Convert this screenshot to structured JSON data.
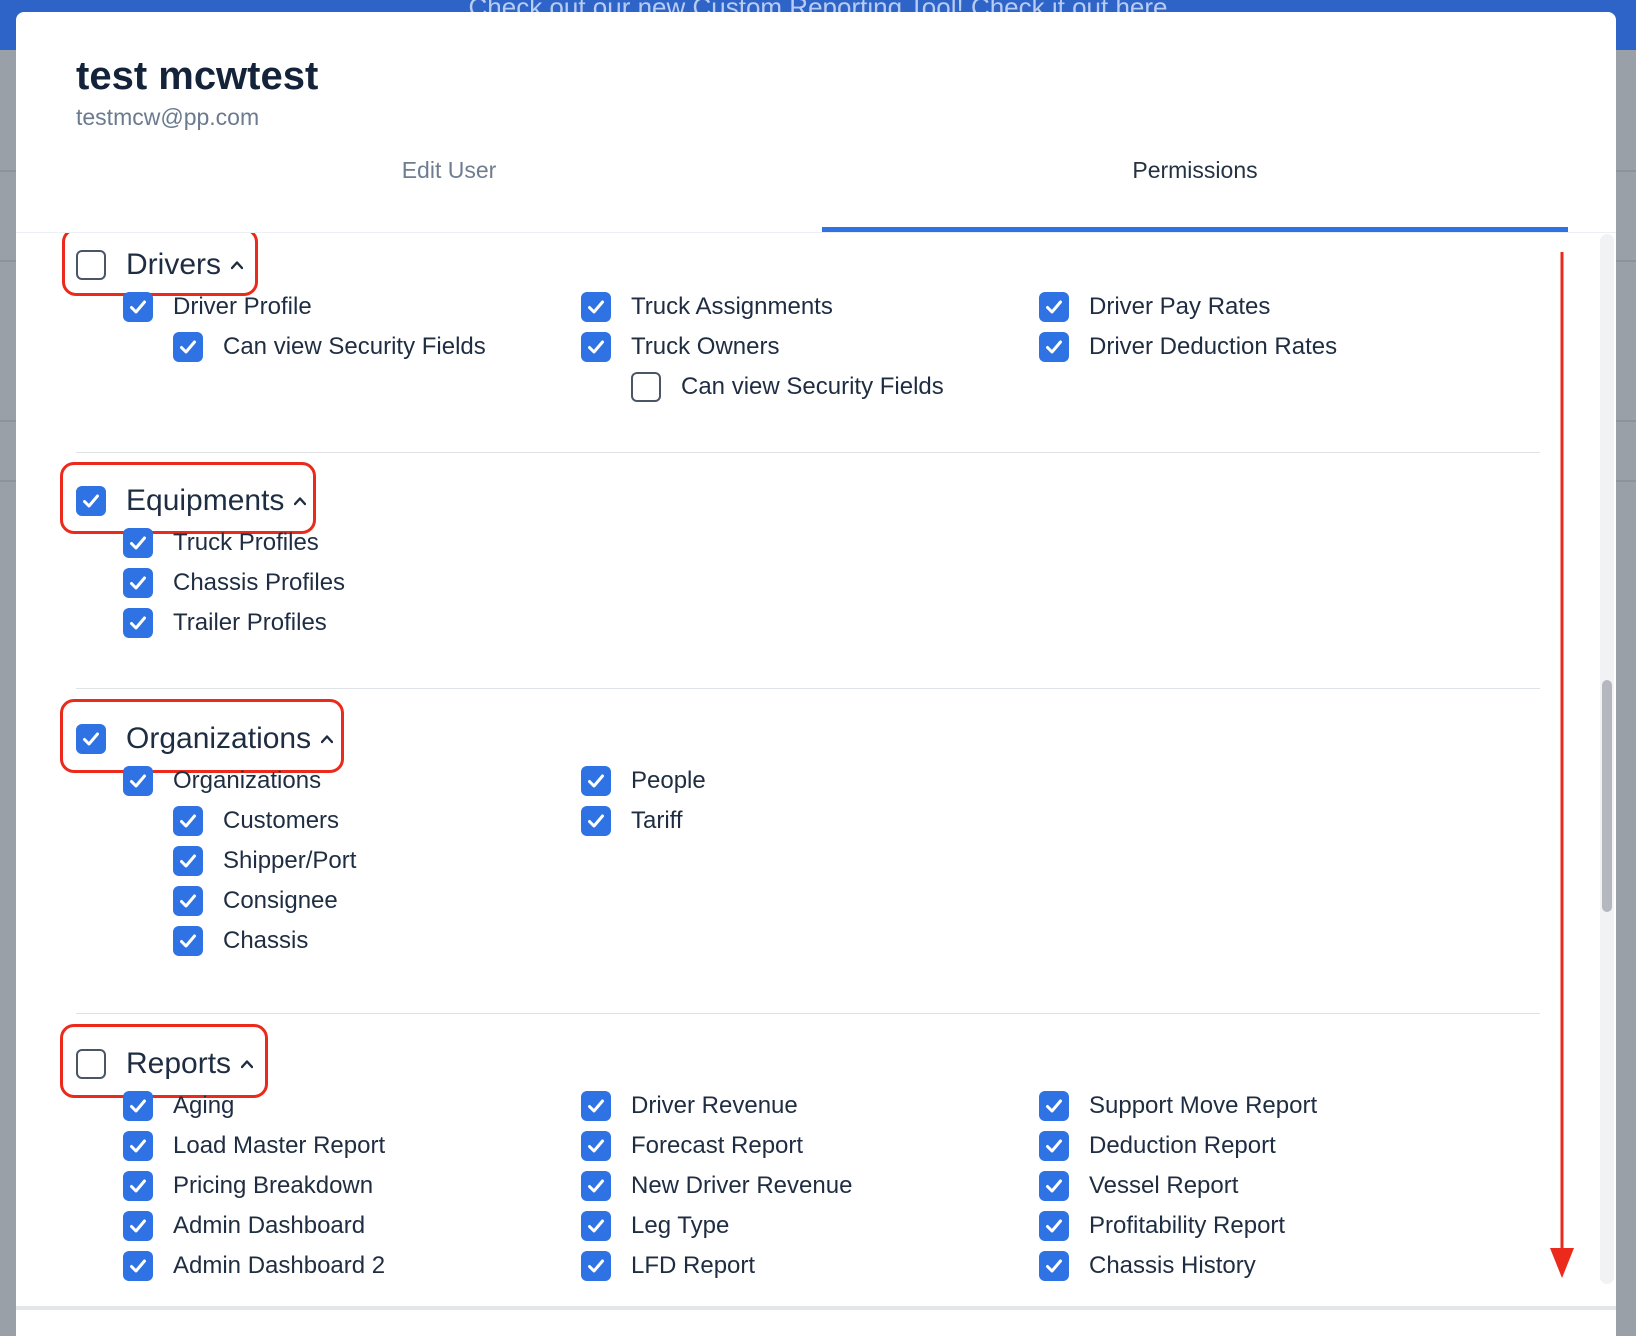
{
  "banner": {
    "text": "Check out our new Custom Reporting Tool!  Check it out here"
  },
  "user": {
    "name": "test mcwtest",
    "email": "testmcw@pp.com"
  },
  "tabs": [
    {
      "label": "Edit User",
      "active": false
    },
    {
      "label": "Permissions",
      "active": true
    }
  ],
  "sections": {
    "drivers": {
      "title": "Drivers",
      "checked": false,
      "items": [
        {
          "label": "Driver Profile",
          "checked": true
        },
        {
          "label": "Can view Security Fields",
          "checked": true
        },
        {
          "label": "Truck Assignments",
          "checked": true
        },
        {
          "label": "Truck Owners",
          "checked": true
        },
        {
          "label": "Can view Security Fields",
          "checked": false
        },
        {
          "label": "Driver Pay Rates",
          "checked": true
        },
        {
          "label": "Driver Deduction Rates",
          "checked": true
        }
      ]
    },
    "equipments": {
      "title": "Equipments",
      "checked": true,
      "items": [
        {
          "label": "Truck Profiles",
          "checked": true
        },
        {
          "label": "Chassis Profiles",
          "checked": true
        },
        {
          "label": "Trailer Profiles",
          "checked": true
        }
      ]
    },
    "organizations": {
      "title": "Organizations",
      "checked": true,
      "items": [
        {
          "label": "Organizations",
          "checked": true
        },
        {
          "label": "Customers",
          "checked": true
        },
        {
          "label": "Shipper/Port",
          "checked": true
        },
        {
          "label": "Consignee",
          "checked": true
        },
        {
          "label": "Chassis",
          "checked": true
        },
        {
          "label": "People",
          "checked": true
        },
        {
          "label": "Tariff",
          "checked": true
        }
      ]
    },
    "reports": {
      "title": "Reports",
      "checked": false,
      "items": [
        {
          "label": "Aging",
          "checked": true
        },
        {
          "label": "Load Master Report",
          "checked": true
        },
        {
          "label": "Pricing Breakdown",
          "checked": true
        },
        {
          "label": "Admin Dashboard",
          "checked": true
        },
        {
          "label": "Admin Dashboard 2",
          "checked": true
        },
        {
          "label": "Driver Revenue",
          "checked": true
        },
        {
          "label": "Forecast Report",
          "checked": true
        },
        {
          "label": "New Driver Revenue",
          "checked": true
        },
        {
          "label": "Leg Type",
          "checked": true
        },
        {
          "label": "LFD Report",
          "checked": true
        },
        {
          "label": "Support Move Report",
          "checked": true
        },
        {
          "label": "Deduction Report",
          "checked": true
        },
        {
          "label": "Vessel Report",
          "checked": true
        },
        {
          "label": "Profitability Report",
          "checked": true
        },
        {
          "label": "Chassis History",
          "checked": true
        }
      ]
    }
  },
  "colors": {
    "accent": "#2f72e3",
    "highlight": "#ec2a1c",
    "text": "#1f2d42"
  }
}
